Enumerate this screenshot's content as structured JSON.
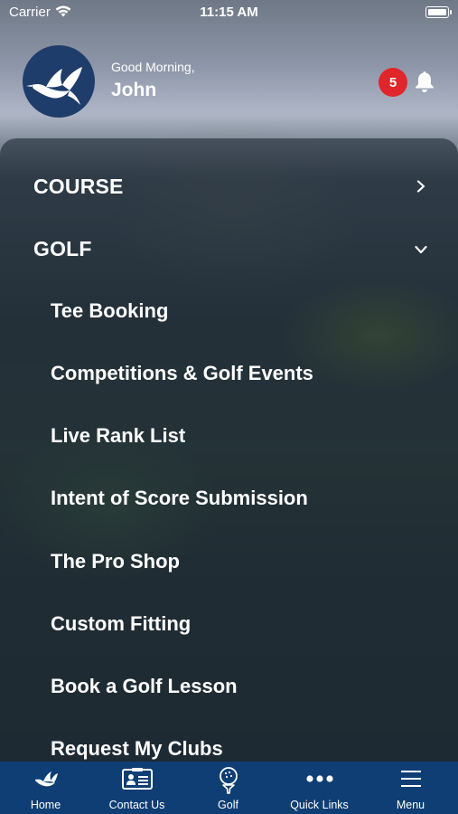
{
  "status_bar": {
    "carrier": "Carrier",
    "time": "11:15 AM"
  },
  "header": {
    "greeting": "Good Morning,",
    "user_name": "John",
    "notification_count": "5",
    "logo_icon": "swan-logo-icon",
    "bell_icon": "bell-icon"
  },
  "menu": {
    "sections": [
      {
        "label": "COURSE",
        "state": "collapsed",
        "icon": "chevron-right-icon"
      },
      {
        "label": "GOLF",
        "state": "expanded",
        "icon": "chevron-down-icon"
      }
    ],
    "golf_items": [
      "Tee Booking",
      "Competitions & Golf Events",
      "Live Rank List",
      "Intent of Score Submission",
      "The Pro Shop",
      "Custom Fitting",
      "Book a Golf Lesson",
      "Request My Clubs"
    ]
  },
  "tabbar": {
    "tabs": [
      {
        "label": "Home",
        "icon": "swan-icon"
      },
      {
        "label": "Contact Us",
        "icon": "contact-card-icon"
      },
      {
        "label": "Golf",
        "icon": "golf-ball-tee-icon"
      },
      {
        "label": "Quick Links",
        "icon": "more-dots-icon"
      },
      {
        "label": "Menu",
        "icon": "hamburger-menu-icon"
      }
    ]
  },
  "colors": {
    "tabbar_bg": "#0f3e74",
    "badge_bg": "#e0262a",
    "logo_bg": "#1f3d6b",
    "text": "#ffffff"
  }
}
